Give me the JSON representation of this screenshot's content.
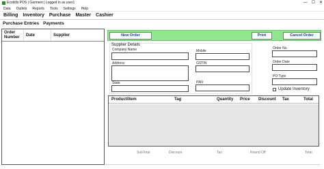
{
  "window": {
    "title": "Ecobills POS | Garment | Logged in as user1",
    "minimize": "—",
    "maximize": "☐",
    "close": "✕"
  },
  "menu": [
    "Data",
    "Outlets",
    "Reports",
    "Tools",
    "Settings",
    "Help"
  ],
  "nav": [
    "Billing",
    "Inventory",
    "Purchase",
    "Master",
    "Cashier"
  ],
  "subtabs": [
    "Purchase Entries",
    "Payments"
  ],
  "left_table": {
    "col_order": "Order Number",
    "col_date": "Date",
    "col_supplier": "Supplier"
  },
  "actions": {
    "new_order": "New Order",
    "print": "Print",
    "cancel_order": "Cancel Order"
  },
  "supplier": {
    "section_title": "Supplier Details",
    "company_name": "Company Name",
    "mobile": "Mobile",
    "address": "Address",
    "gstin": "GSTIN",
    "state": "State",
    "pan": "PAN"
  },
  "order": {
    "order_no": "Order No.",
    "order_date": "Order Date",
    "po_type": "PO Type",
    "update_inventory": "Update Inventory"
  },
  "items_table": {
    "product": "Product/Item",
    "tag": "Tag",
    "quantity": "Quantity",
    "price": "Price",
    "discount": "Discount",
    "tax": "Tax",
    "total": "Total"
  },
  "totals": {
    "subtotal": "SubTotal",
    "discount": "Discount",
    "tax": "Tax",
    "round_off": "Round Off",
    "total": "Total"
  }
}
